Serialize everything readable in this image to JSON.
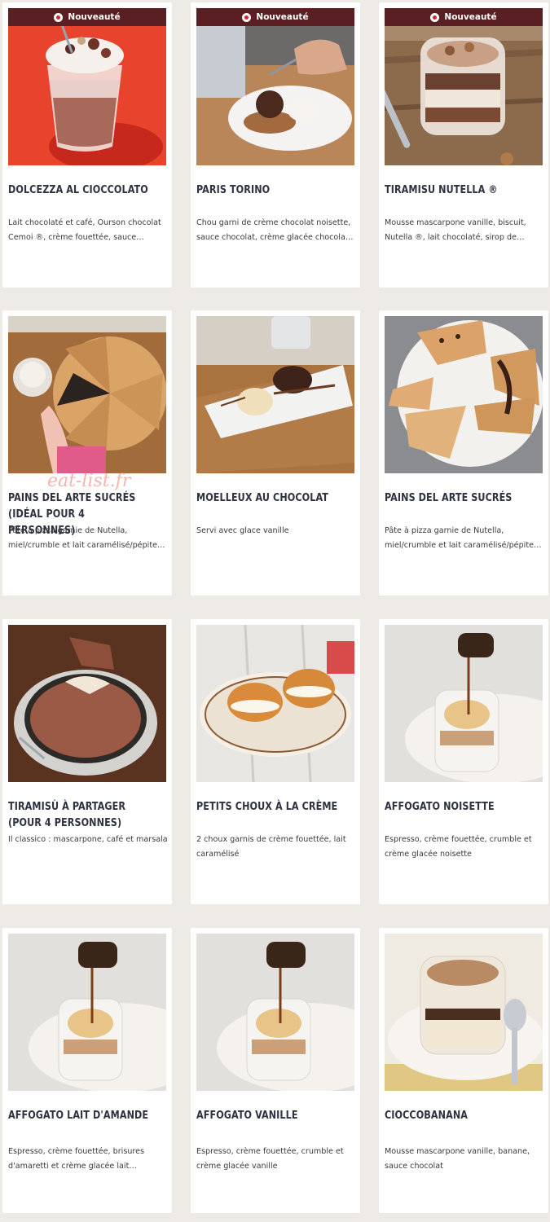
{
  "watermark": "eat-list.fr",
  "badge_label": "Nouveauté",
  "colors": {
    "page_background": "#eeebe6",
    "card_background": "#ffffff",
    "badge_background": "#5a1f22",
    "badge_dot": "#d8252a",
    "title_text": "#2d3140"
  },
  "products": [
    {
      "title": "Dolcezza al Cioccolato",
      "description": "Lait chocolaté et café, Ourson chocolat Cemoi ®, crème fouettée, sauce…",
      "new": true,
      "image_icon": "hot-chocolate-glass-icon"
    },
    {
      "title": "Paris Torino",
      "description": "Chou garni de crème chocolat noisette, sauce chocolat, crème glacée chocola…",
      "new": true,
      "image_icon": "choux-plate-icon"
    },
    {
      "title": "Tiramisu Nutella ®",
      "description": "Mousse mascarpone vanille, biscuit, Nutella ®, lait chocolaté, sirop de…",
      "new": true,
      "image_icon": "tiramisu-jar-icon"
    },
    {
      "title": "Pains del Arte sucrés (idéal pour 4 personnes)",
      "description": "Pâte à pizza garnie de Nutella, miel/crumble et lait caramélisé/pépite…",
      "new": false,
      "image_icon": "sweet-pizza-board-icon"
    },
    {
      "title": "Moelleux au chocolat",
      "description": "Servi avec glace vanille",
      "new": false,
      "image_icon": "lava-cake-plate-icon"
    },
    {
      "title": "Pains del Arte sucrés",
      "description": "Pâte à pizza garnie de Nutella, miel/crumble et lait caramélisé/pépite…",
      "new": false,
      "image_icon": "sweet-bread-plate-icon"
    },
    {
      "title": "Tiramisù à partager (pour 4 personnes)",
      "description": "Il classico : mascarpone, café et marsala",
      "new": false,
      "image_icon": "tiramisu-dish-icon"
    },
    {
      "title": "Petits choux à la crème",
      "description": "2 choux garnis de crème fouettée, lait caramélisé",
      "new": false,
      "image_icon": "cream-puffs-plate-icon"
    },
    {
      "title": "Affogato noisette",
      "description": "Espresso, crème fouettée, crumble et crème glacée noisette",
      "new": false,
      "image_icon": "affogato-glass-icon"
    },
    {
      "title": "Affogato lait d'amande",
      "description": "Espresso, crème fouettée, brisures d'amaretti et crème glacée lait…",
      "new": false,
      "image_icon": "affogato-glass-icon"
    },
    {
      "title": "Affogato vanille",
      "description": "Espresso, crème fouettée, crumble et crème glacée vanille",
      "new": false,
      "image_icon": "affogato-glass-icon"
    },
    {
      "title": "Cioccobanana",
      "description": "Mousse mascarpone vanille, banane, sauce chocolat",
      "new": false,
      "image_icon": "dessert-jar-spoon-icon"
    }
  ]
}
